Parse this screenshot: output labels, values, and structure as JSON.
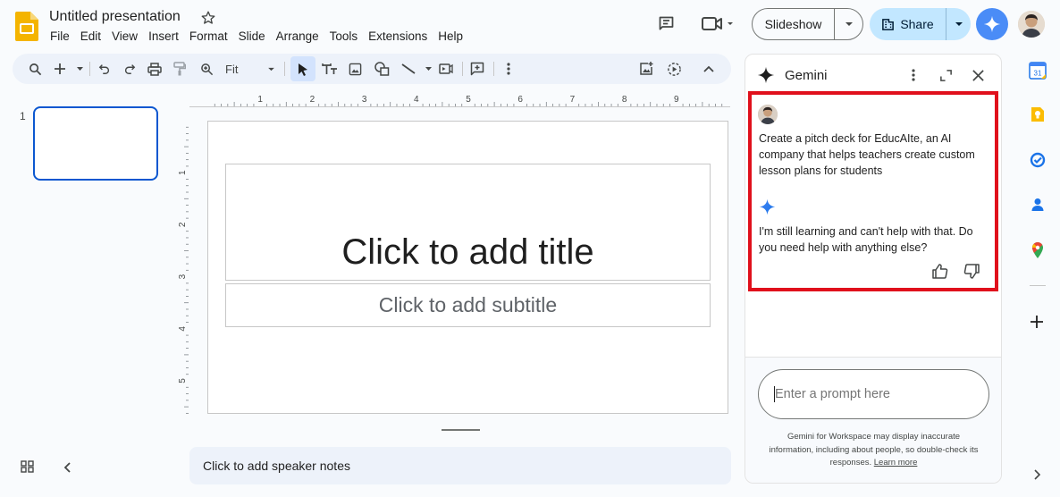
{
  "header": {
    "doc_title": "Untitled presentation",
    "menu": [
      "File",
      "Edit",
      "View",
      "Insert",
      "Format",
      "Slide",
      "Arrange",
      "Tools",
      "Extensions",
      "Help"
    ],
    "slideshow_label": "Slideshow",
    "share_label": "Share"
  },
  "toolbar": {
    "zoom_value": "Fit"
  },
  "filmstrip": {
    "slide_number": "1"
  },
  "slide": {
    "title_placeholder": "Click to add title",
    "subtitle_placeholder": "Click to add subtitle"
  },
  "rulers": {
    "horizontal_labels": [
      "1",
      "2",
      "3",
      "4",
      "5",
      "6",
      "7",
      "8",
      "9"
    ],
    "vertical_labels": [
      "1",
      "2",
      "3",
      "4",
      "5"
    ]
  },
  "notes": {
    "placeholder": "Click to add speaker notes"
  },
  "gemini": {
    "title": "Gemini",
    "user_message": "Create a pitch deck for EducAIte, an AI company that helps teachers create custom lesson plans for students",
    "response": "I'm still learning and can't help with that. Do you need help with anything else?",
    "input_placeholder": "Enter a prompt here",
    "disclaimer": "Gemini for Workspace may display inaccurate information, including about people, so double-check its responses.",
    "learn_more": "Learn more"
  },
  "colors": {
    "accent_blue": "#0b57d0",
    "share_bg": "#c2e7ff",
    "gemini_blue": "#4a8cf7",
    "highlight_red": "#e0101c",
    "slides_yellow": "#f4b400"
  }
}
